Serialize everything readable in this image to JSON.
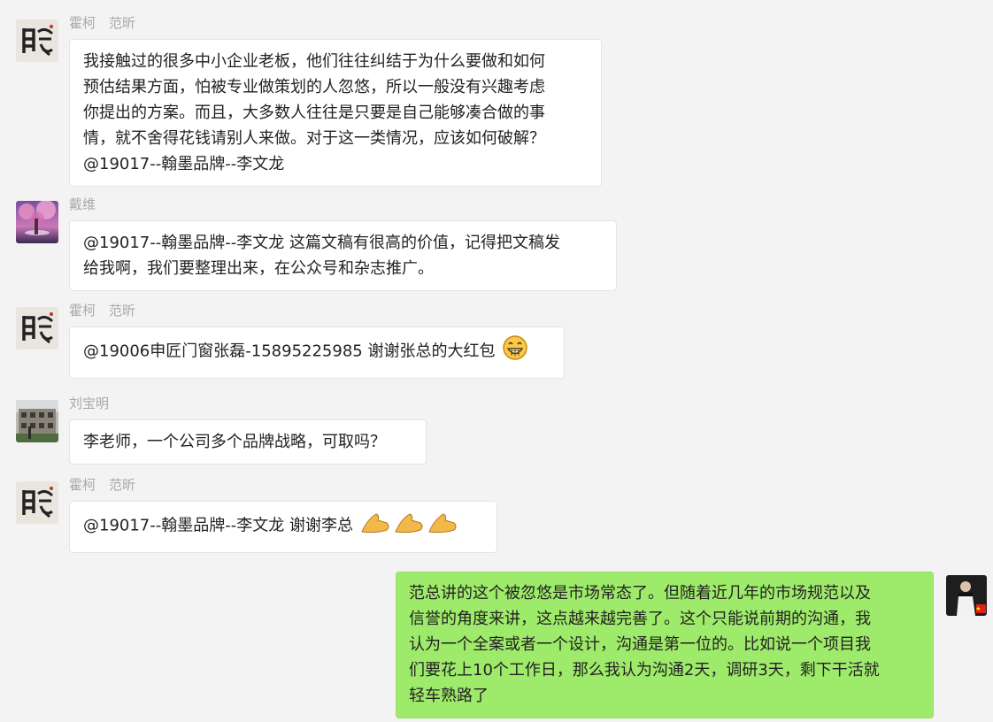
{
  "messages": [
    {
      "sender": "霍柯　范昕",
      "lines": [
        "我接触过的很多中小企业老板，他们往往纠结于为什么要做和如何",
        "预估结果方面，怕被专业做策划的人忽悠，所以一般没有兴趣考虑",
        "你提出的方案。而且，大多数人往往是只要是自己能够凑合做的事",
        "情，就不舍得花钱请别人来做。对于这一类情况，应该如何破解？",
        "@19017--翰墨品牌--李文龙"
      ]
    },
    {
      "sender": "戴维",
      "lines": [
        "@19017--翰墨品牌--李文龙 这篇文稿有很高的价值，记得把文稿发",
        "给我啊，我们要整理出来，在公众号和杂志推广。"
      ]
    },
    {
      "sender": "霍柯　范昕",
      "lines": [
        "@19006申匠门窗张磊-15895225985 谢谢张总的大红包"
      ],
      "emoji": "grinning-face-icon"
    },
    {
      "sender": "刘宝明",
      "lines": [
        "李老师，一个公司多个品牌战略，可取吗？"
      ]
    },
    {
      "sender": "霍柯　范昕",
      "lines": [
        "@19017--翰墨品牌--李文龙 谢谢李总"
      ],
      "emoji": "bowing-hands-icon"
    },
    {
      "sender": "",
      "self": true,
      "lines": [
        "范总讲的这个被忽悠是市场常态了。但随着近几年的市场规范以及",
        "信誉的角度来讲，这点越来越完善了。这个只能说前期的沟通，我",
        "认为一个全案或者一个设计，沟通是第一位的。比如说一个项目我",
        "们要花上10个工作日，那么我认为沟通2天，调研3天，剩下干活就",
        "轻车熟路了"
      ]
    }
  ],
  "colors": {
    "background": "#f3f3f3",
    "self_bubble": "#9eea6a",
    "other_bubble": "#ffffff",
    "sender_name": "#a8a8a8"
  }
}
